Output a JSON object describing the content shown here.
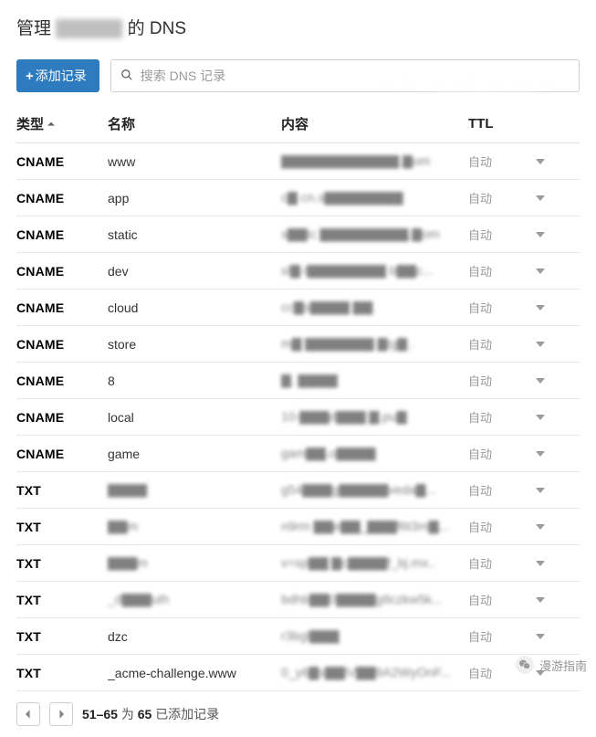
{
  "header": {
    "title_prefix": "管理",
    "title_domain_obscured": "▇▇▇▇n",
    "title_suffix": "的 DNS"
  },
  "toolbar": {
    "add_label": "添加记录",
    "search_placeholder": "搜索 DNS 记录"
  },
  "columns": {
    "type": "类型",
    "name": "名称",
    "content": "内容",
    "ttl": "TTL"
  },
  "ttl_auto": "自动",
  "records": [
    {
      "type": "CNAME",
      "name": "www",
      "name_blurred": false,
      "content": "▇▇▇▇▇▇▇▇▇▇▇▇.▇om",
      "content_blurred": true
    },
    {
      "type": "CNAME",
      "name": "app",
      "name_blurred": false,
      "content": "c▇ cn.s▇▇▇▇▇▇▇▇",
      "content_blurred": true
    },
    {
      "type": "CNAME",
      "name": "static",
      "name_blurred": false,
      "content": "s▇▇ic ▇▇▇▇▇▇▇▇▇.▇om",
      "content_blurred": true
    },
    {
      "type": "CNAME",
      "name": "dev",
      "name_blurred": false,
      "content": "sl▇-l▇▇▇▇▇▇▇▇ b▇▇c...",
      "content_blurred": true
    },
    {
      "type": "CNAME",
      "name": "cloud",
      "name_blurred": false,
      "content": "cc▇s▇▇▇▇ ▇▇",
      "content_blurred": true
    },
    {
      "type": "CNAME",
      "name": "store",
      "name_blurred": false,
      "content": "m▇ ▇▇▇▇▇▇▇ ▇ig▇ .",
      "content_blurred": true
    },
    {
      "type": "CNAME",
      "name": "8",
      "name_blurred": false,
      "content": "▇. ▇▇▇▇",
      "content_blurred": true
    },
    {
      "type": "CNAME",
      "name": "local",
      "name_blurred": false,
      "content": "10-▇▇▇d▇▇▇ ▇.pu▇",
      "content_blurred": true
    },
    {
      "type": "CNAME",
      "name": "game",
      "name_blurred": false,
      "content": "gam▇▇.o▇▇▇▇",
      "content_blurred": true
    },
    {
      "type": "TXT",
      "name": "▇▇▇▇",
      "name_blurred": true,
      "content": "g54▇▇▇g▇▇▇▇▇veda▇...",
      "content_blurred": true
    },
    {
      "type": "TXT",
      "name": "▇▇m",
      "name_blurred": true,
      "content": "n9rm ▇▇e▇▇_▇▇▇f6t3m▇...",
      "content_blurred": true
    },
    {
      "type": "TXT",
      "name": "▇▇▇m",
      "name_blurred": true,
      "content": "v=sp▇▇ ▇c▇▇▇▇f_bj.mx..",
      "content_blurred": true
    },
    {
      "type": "TXT",
      "name": "_d▇▇▇uth",
      "name_blurred": true,
      "content": "bdhb▇▇0▇▇▇▇g8czkw5k...",
      "content_blurred": true
    },
    {
      "type": "TXT",
      "name": "dzc",
      "name_blurred": false,
      "content": "r3bgl▇▇▇",
      "content_blurred": true
    },
    {
      "type": "TXT",
      "name": "_acme-challenge.www",
      "name_blurred": false,
      "content": "0_y6▇s▇▇lV▇▇9A2WyOnF...",
      "content_blurred": true
    }
  ],
  "footer": {
    "range": "51–65",
    "of": "为",
    "total": "65",
    "suffix": "已添加记录"
  },
  "watermark": {
    "label": "漫游指南"
  }
}
